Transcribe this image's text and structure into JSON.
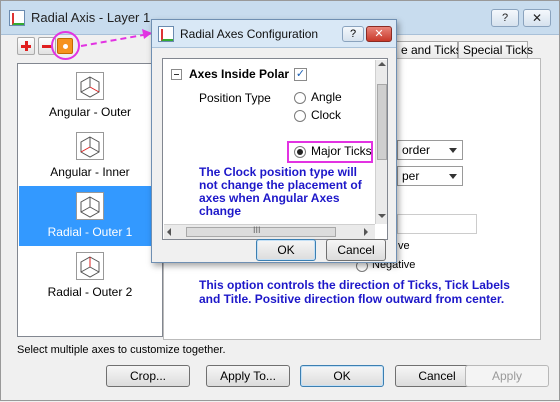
{
  "window": {
    "title": "Radial Axis - Layer 1",
    "help_glyph": "?",
    "close_glyph": "✕"
  },
  "axes_list": [
    {
      "label": "Angular - Outer",
      "selected": false
    },
    {
      "label": "Angular - Inner",
      "selected": false
    },
    {
      "label": "Radial - Outer 1",
      "selected": true
    },
    {
      "label": "Radial - Outer 2",
      "selected": false
    }
  ],
  "tabs": {
    "tab1_label": "e and Ticks",
    "tab2_label": "Special Ticks"
  },
  "background_panel": {
    "combo1_value": "order",
    "combo2_value": "per",
    "radio_label_1": "ve",
    "radio_label_2": "Negative",
    "note": "This option controls the direction of Ticks, Tick Labels and Title. Positive direction flow outward from center."
  },
  "bottom": {
    "hint": "Select multiple axes to customize together.",
    "crop_label": "Crop...",
    "apply_to_label": "Apply To...",
    "ok_label": "OK",
    "cancel_label": "Cancel",
    "apply_label": "Apply"
  },
  "dialog": {
    "title": "Radial Axes Configuration",
    "help_glyph": "?",
    "close_glyph": "✕",
    "section_title": "Axes Inside Polar",
    "section_checked": true,
    "check_glyph": "✓",
    "position_type_label": "Position Type",
    "options": [
      {
        "label": "Angle",
        "selected": false
      },
      {
        "label": "Clock",
        "selected": false
      },
      {
        "label": "Major Ticks",
        "selected": true
      }
    ],
    "note": "The Clock position type will not change the placement of axes when Angular Axes change",
    "scroll_thumb_glyph": "III",
    "ok_label": "OK",
    "cancel_label": "Cancel"
  },
  "colors": {
    "accent_magenta": "#e233e2",
    "note_blue": "#1d17c9",
    "selection_blue": "#3399ff",
    "close_red": "#c8392a"
  }
}
